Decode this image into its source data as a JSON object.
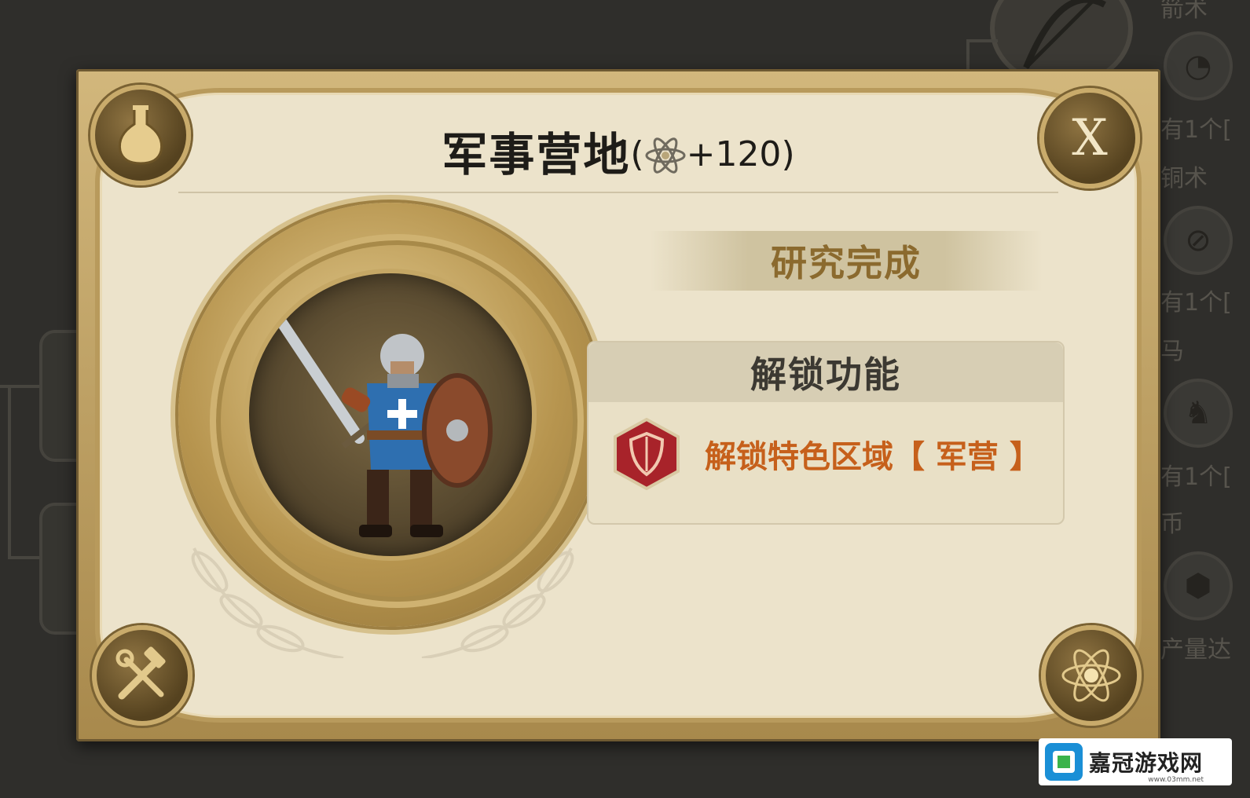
{
  "dialog": {
    "title": "军事营地",
    "bonus_open": "(",
    "bonus_value": "+120",
    "bonus_close": ")",
    "close_label": "X",
    "status": "研究完成",
    "unlock_header": "解锁功能",
    "unlock_items": [
      {
        "label": "解锁特色区域【 军营 】",
        "icon": "shield-icon"
      }
    ],
    "corner_icons": [
      "flask-icon",
      "close-icon",
      "tools-icon",
      "atom-icon"
    ],
    "unit_image": "knight-soldier-illustration"
  },
  "background": {
    "tree_labels": [
      "箭术",
      "有1个[",
      "铜术",
      "有1个[",
      "马",
      "有1个[",
      "币",
      "产量达"
    ]
  },
  "watermark": {
    "text": "嘉冠游戏网",
    "url": "www.03mm.net"
  },
  "colors": {
    "frame_gold": "#c9ab6b",
    "parchment": "#ece3cb",
    "title_text": "#1e1c18",
    "status_text": "#8b6a2e",
    "unlock_text": "#c6601b",
    "shield_red": "#a8232a"
  }
}
